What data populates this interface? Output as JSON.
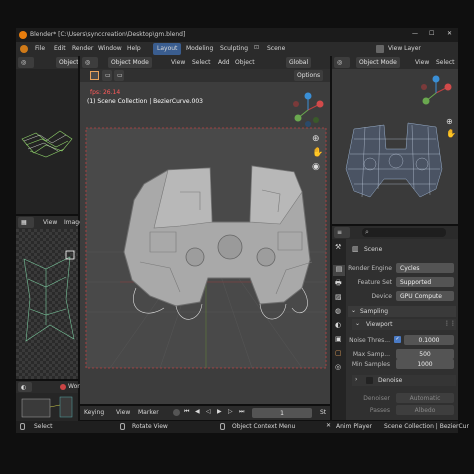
{
  "window": {
    "title": "Blender* [C:\\Users\\synccreation\\Desktop\\gm.blend]",
    "controls": [
      "—",
      "☐",
      "✕"
    ]
  },
  "menubar": {
    "items": [
      "File",
      "Edit",
      "Render",
      "Window",
      "Help"
    ],
    "workspaces": [
      "Layout",
      "Modeling",
      "Sculpting"
    ],
    "scene_label": "Scene",
    "view_layer_label": "View Layer"
  },
  "left_top": {
    "mode": "Object"
  },
  "viewport": {
    "mode": "Object Mode",
    "menus": [
      "View",
      "Select",
      "Add",
      "Object"
    ],
    "transform": "Global",
    "options": "Options",
    "fps": "fps: 26.14",
    "collection": "(1) Scene Collection | BezierCurve.003"
  },
  "left_mid": {
    "menus": [
      "View",
      "Image"
    ]
  },
  "left_bottom": {
    "label": "World"
  },
  "timeline": {
    "menus": [
      "Keying",
      "View",
      "Marker"
    ],
    "frame": "1",
    "start": "St"
  },
  "right_viewport": {
    "mode": "Object Mode",
    "menus": [
      "View",
      "Select"
    ]
  },
  "properties": {
    "scene": "Scene",
    "render_engine_label": "Render Engine",
    "render_engine": "Cycles",
    "feature_set_label": "Feature Set",
    "feature_set": "Supported",
    "device_label": "Device",
    "device": "GPU Compute",
    "sampling": "Sampling",
    "viewport": "Viewport",
    "noise_threshold_label": "Noise Thres...",
    "noise_threshold": "0.1000",
    "max_samples_label": "Max Samp...",
    "max_samples": "500",
    "min_samples_label": "Min Samples",
    "min_samples": "1000",
    "denoise": "Denoise",
    "denoiser_label": "Denoiser",
    "denoiser": "Automatic",
    "passes_label": "Passes",
    "passes": "Albedo"
  },
  "statusbar": {
    "select": "Select",
    "rotate": "Rotate View",
    "context": "Object Context Menu",
    "anim": "Anim Player",
    "info": "Scene Collection | BezierCur"
  },
  "colors": {
    "accent": "#3a5d8f",
    "header": "#2b2b2b",
    "viewport": "#3d3d3d",
    "selection": "#e8a35c"
  }
}
